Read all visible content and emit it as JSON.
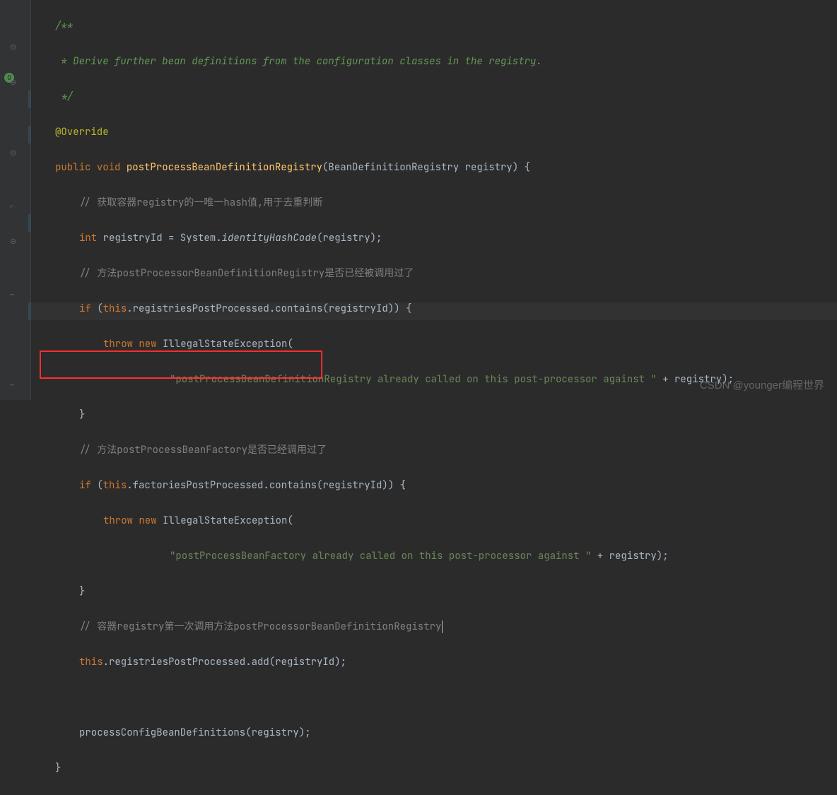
{
  "code": {
    "jd1": "/**",
    "jd2": " * Derive further bean definitions from the configuration classes in the registry.",
    "jd3": " */",
    "ann": "@Override",
    "kw_public": "public",
    "kw_void": "void",
    "methodName": "postProcessBeanDefinitionRegistry",
    "sig_open": "(BeanDefinitionRegistry registry) {",
    "c1": "// 获取容器registry的一唯一hash值,用于去重判断",
    "kw_int": "int",
    "l_registryId_eq": " registryId = System.",
    "m_idhash": "identityHashCode",
    "l_idhash_tail": "(registry);",
    "c2": "// 方法postProcessorBeanDefinitionRegistry是否已经被调用过了",
    "kw_if1": "if",
    "l_if1": " (",
    "kw_this1": "this",
    "l_if1b": ".registriesPostProcessed.contains(registryId)) {",
    "kw_throw1": "throw",
    "kw_new1": "new",
    "l_throw1": " IllegalStateException(",
    "s1": "\"postProcessBeanDefinitionRegistry already called on this post-processor against \"",
    "l_s1_tail": " + registry);",
    "l_brace1": "}",
    "c3": "// 方法postProcessBeanFactory是否已经调用过了",
    "kw_if2": "if",
    "l_if2": " (",
    "kw_this2": "this",
    "l_if2b": ".factoriesPostProcessed.contains(registryId)) {",
    "kw_throw2": "throw",
    "kw_new2": "new",
    "l_throw2": " IllegalStateException(",
    "s2": "\"postProcessBeanFactory already called on this post-processor against \"",
    "l_s2_tail": " + registry);",
    "l_brace2": "}",
    "c4": "// 容器registry第一次调用方法postProcessorBeanDefinitionRegistry",
    "kw_this3": "this",
    "l_add": ".registriesPostProcessed.add(registryId);",
    "l_blank": "",
    "l_call": "processConfigBeanDefinitions(registry);",
    "l_close": "}"
  },
  "watermark": "CSDN @younger编程世界",
  "gutter": {
    "override": "O"
  }
}
